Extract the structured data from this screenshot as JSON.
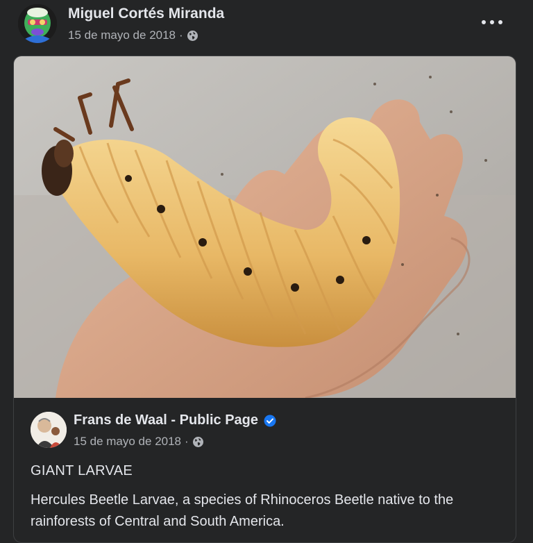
{
  "post": {
    "author": "Miguel Cortés Miranda",
    "date": "15 de mayo de 2018",
    "separator": "·",
    "audience_icon": "globe-icon",
    "more_icon": "more-options-icon"
  },
  "shared": {
    "photo_subject": "larva-photo",
    "page_name": "Frans de Waal - Public Page",
    "verified_icon": "verified-badge-icon",
    "date": "15 de mayo de 2018",
    "separator": "·",
    "title": "GIANT LARVAE",
    "body": "Hercules Beetle Larvae, a species of Rhinoceros Beetle native to the rainforests of Central and South America."
  },
  "colors": {
    "background": "#242526",
    "text_primary": "#e4e6eb",
    "text_secondary": "#b0b3b8",
    "verified_blue": "#1877f2"
  }
}
